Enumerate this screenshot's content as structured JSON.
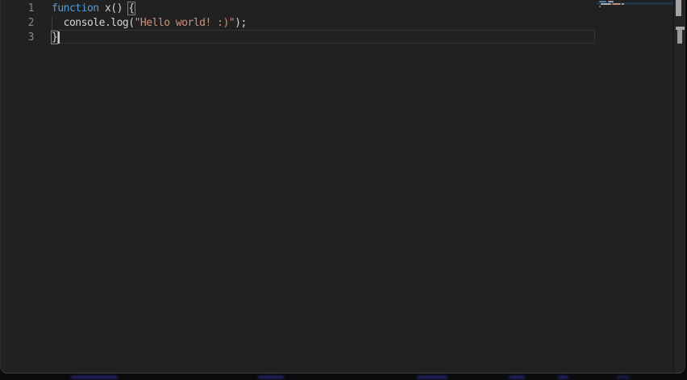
{
  "editor": {
    "lines": [
      {
        "number": "1",
        "tokens": [
          {
            "t": "function",
            "type": "keyword"
          },
          {
            "t": " x() ",
            "type": "plain"
          },
          {
            "t": "{",
            "type": "bracket-match"
          }
        ]
      },
      {
        "number": "2",
        "tokens": [
          {
            "t": "  console.log(",
            "type": "plain"
          },
          {
            "t": "\"Hello world! :)\"",
            "type": "string"
          },
          {
            "t": ");",
            "type": "plain"
          }
        ]
      },
      {
        "number": "3",
        "tokens": [
          {
            "t": "}",
            "type": "bracket-match"
          }
        ]
      }
    ],
    "cursor": {
      "line": 3,
      "after_text": "}"
    }
  },
  "minimap": {
    "highlighted_line": 2
  },
  "colors": {
    "bg": "#212121",
    "fg": "#d4d4d4",
    "keyword": "#569cd6",
    "string": "#ce9178",
    "lineNumber": "#858585",
    "minimapBand": "#1e3448",
    "scrollbar": "#a5a5a5"
  }
}
